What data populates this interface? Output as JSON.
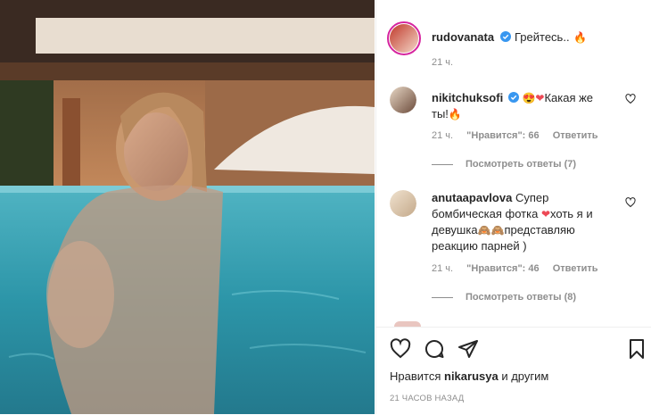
{
  "caption": {
    "username": "rudovanata",
    "text": "Грейтесь..",
    "emoji": "fire-emoji",
    "time": "21 ч."
  },
  "comments": [
    {
      "username": "nikitchuksofi",
      "text_line1": "Какая же",
      "text_line2": "ты!",
      "time": "21 ч.",
      "likes": "\"Нравится\": 66",
      "reply": "Ответить",
      "view_replies": "Посмотреть ответы (7)"
    },
    {
      "username": "anutaapavlova",
      "text_line1": "Супер",
      "text_line2": "бомбическая фотка",
      "text_line2b": "хоть я и",
      "text_line3": "девушка",
      "text_line3b": "представляю",
      "text_line4": "реакцию парней )",
      "time": "21 ч.",
      "likes": "\"Нравится\": 46",
      "reply": "Ответить",
      "view_replies": "Посмотреть ответы (8)"
    }
  ],
  "footer": {
    "likes_prefix": "Нравится",
    "likes_user": "nikarusya",
    "likes_suffix": "и другим",
    "timestamp": "21 часов назад"
  },
  "colors": {
    "verified": "#3897f0",
    "heart_red": "#ed4956",
    "pool": "#2a8fa3"
  }
}
